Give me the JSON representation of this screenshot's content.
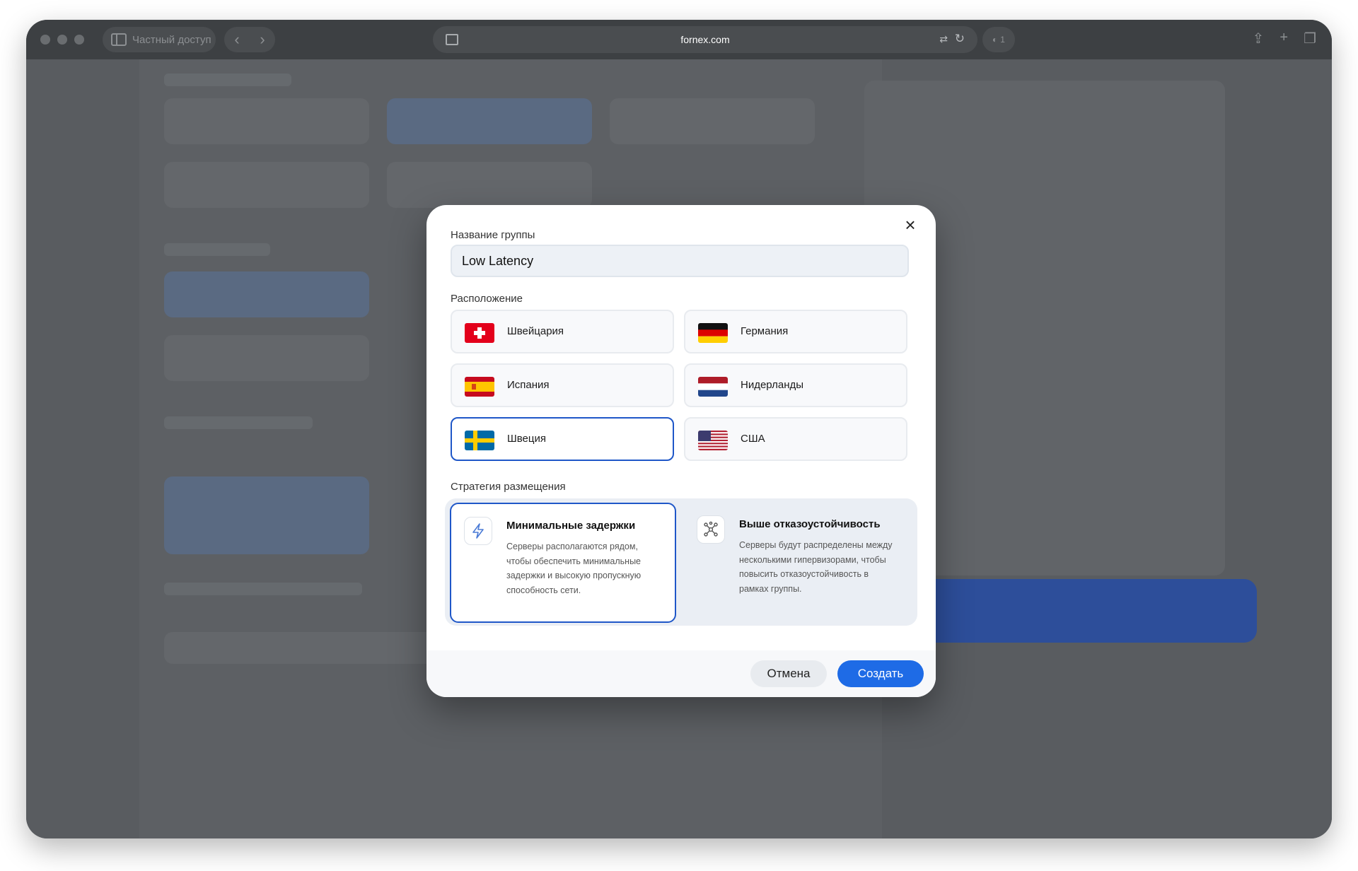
{
  "browser": {
    "private_label": "Частный доступ",
    "url": "fornex.com",
    "ext_badge": "1"
  },
  "modal": {
    "group_name_label": "Название группы",
    "group_name_value": "Low Latency",
    "location_label": "Расположение",
    "locations": [
      {
        "name": "Швейцария",
        "flag": "switzerland-flag",
        "selected": false
      },
      {
        "name": "Германия",
        "flag": "germany-flag",
        "selected": false
      },
      {
        "name": "Испания",
        "flag": "spain-flag",
        "selected": false
      },
      {
        "name": "Нидерланды",
        "flag": "netherlands-flag",
        "selected": false
      },
      {
        "name": "Швеция",
        "flag": "sweden-flag",
        "selected": true
      },
      {
        "name": "США",
        "flag": "usa-flag",
        "selected": false
      }
    ],
    "strategy_label": "Стратегия размещения",
    "strategies": [
      {
        "title": "Минимальные задержки",
        "description": "Серверы располагаются рядом, чтобы обеспечить минимальные задержки и высокую пропускную способность сети.",
        "icon": "lightning-icon",
        "selected": true
      },
      {
        "title": "Выше отказоустойчивость",
        "description": "Серверы будут распределены между несколькими гипервизорами, чтобы повысить отказоустойчивость в рамках группы.",
        "icon": "network-icon",
        "selected": false
      }
    ],
    "cancel_label": "Отмена",
    "create_label": "Создать"
  },
  "colors": {
    "accent": "#1e6be6",
    "selected_border": "#1f57c8"
  }
}
